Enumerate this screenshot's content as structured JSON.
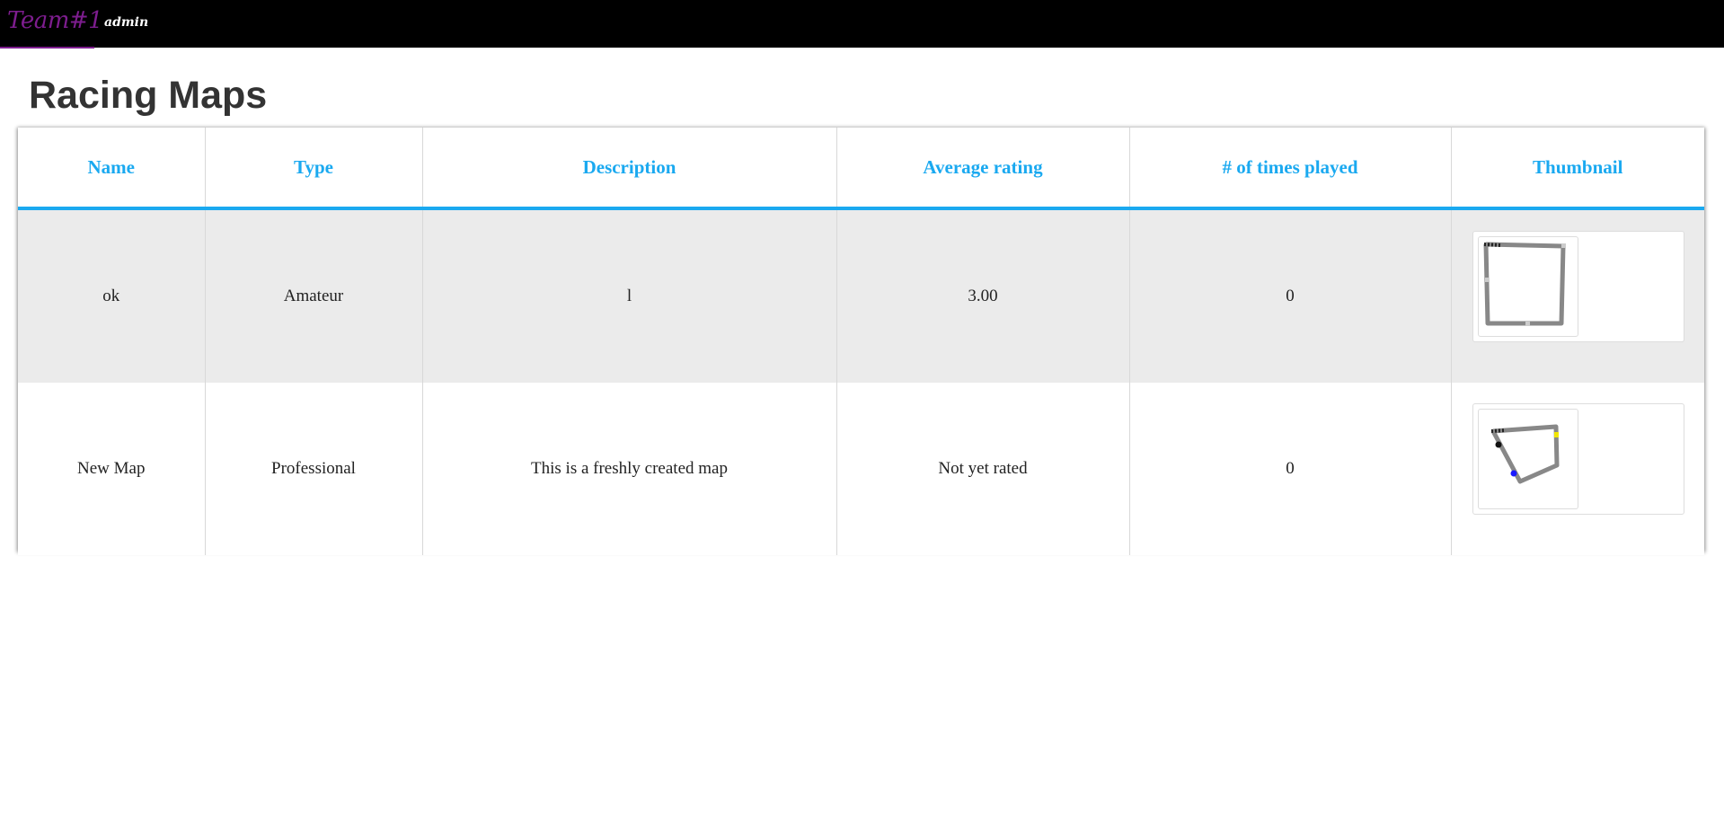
{
  "navbar": {
    "brand": "Team#1",
    "user_link": "admin"
  },
  "page": {
    "title": "Racing Maps"
  },
  "table": {
    "columns": [
      "Name",
      "Type",
      "Description",
      "Average rating",
      "# of times played",
      "Thumbnail"
    ],
    "rows": [
      {
        "name": "ok",
        "type": "Amateur",
        "description": "l",
        "average_rating": "3.00",
        "times_played": "0",
        "thumbnail_icon": "map-thumbnail-square-track"
      },
      {
        "name": "New Map",
        "type": "Professional",
        "description": "This is a freshly created map",
        "average_rating": "Not yet rated",
        "times_played": "0",
        "thumbnail_icon": "map-thumbnail-polygon-track"
      }
    ]
  },
  "colors": {
    "navbar_bg": "#000000",
    "brand": "#7d1d8e",
    "header_accent": "#1aa9f0",
    "row_shade": "#ebebeb",
    "title_text": "#333333"
  }
}
